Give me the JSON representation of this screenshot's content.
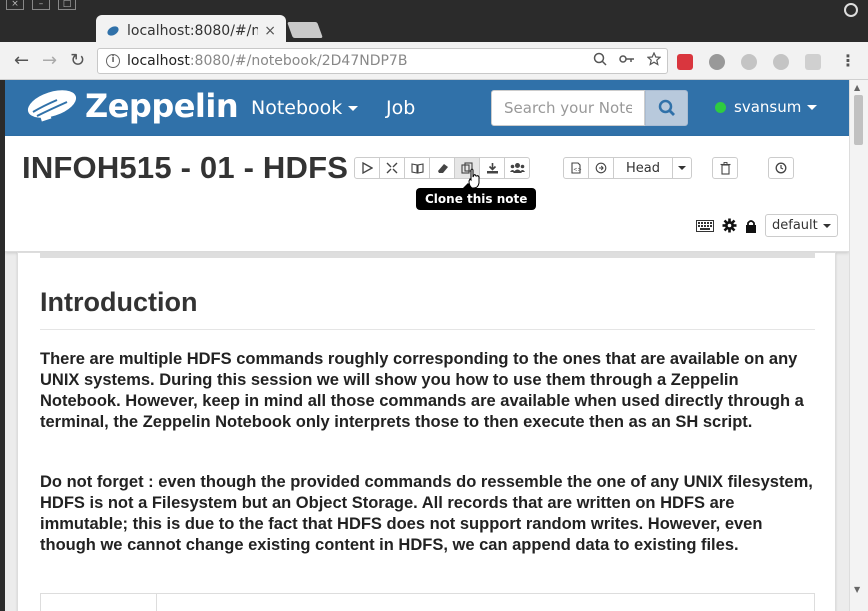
{
  "browser": {
    "tab_title": "localhost:8080/#/n",
    "tab_close": "×",
    "url_host": "localhost",
    "url_rest": ":8080/#/notebook/2D47NDP7B",
    "back": "←",
    "forward": "→",
    "reload": "↻",
    "menu": "⋮"
  },
  "navbar": {
    "brand": "Zeppelin",
    "notebook_label": "Notebook",
    "job_label": "Job",
    "search_placeholder": "Search your Notes",
    "username": "svansum",
    "status_color": "#2ecc40"
  },
  "note": {
    "title": "INFOH515 - 01 - HDFS",
    "head_label": "Head",
    "tooltip": "Clone this note",
    "interpreter_label": "default"
  },
  "paragraph": {
    "heading": "Introduction",
    "p1": "There are multiple HDFS commands roughly corresponding to the ones that are available on any UNIX systems. During this session we will show you how to use them through a Zeppelin Notebook. However, keep in mind all those commands are available when used directly through a terminal, the Zeppelin Notebook only interprets those to then execute then as an SH script.",
    "p2": "Do not forget : even though the provided commands do ressemble the one of any UNIX filesystem, HDFS is not a Filesystem but an Object Storage. All records that are written on HDFS are immutable; this is due to the fact that HDFS does not support random writes. However, even though we cannot change existing content in HDFS, we can append data to existing files."
  },
  "colors": {
    "navbar_bg": "#3071a9",
    "search_btn": "#b8c9dc"
  }
}
